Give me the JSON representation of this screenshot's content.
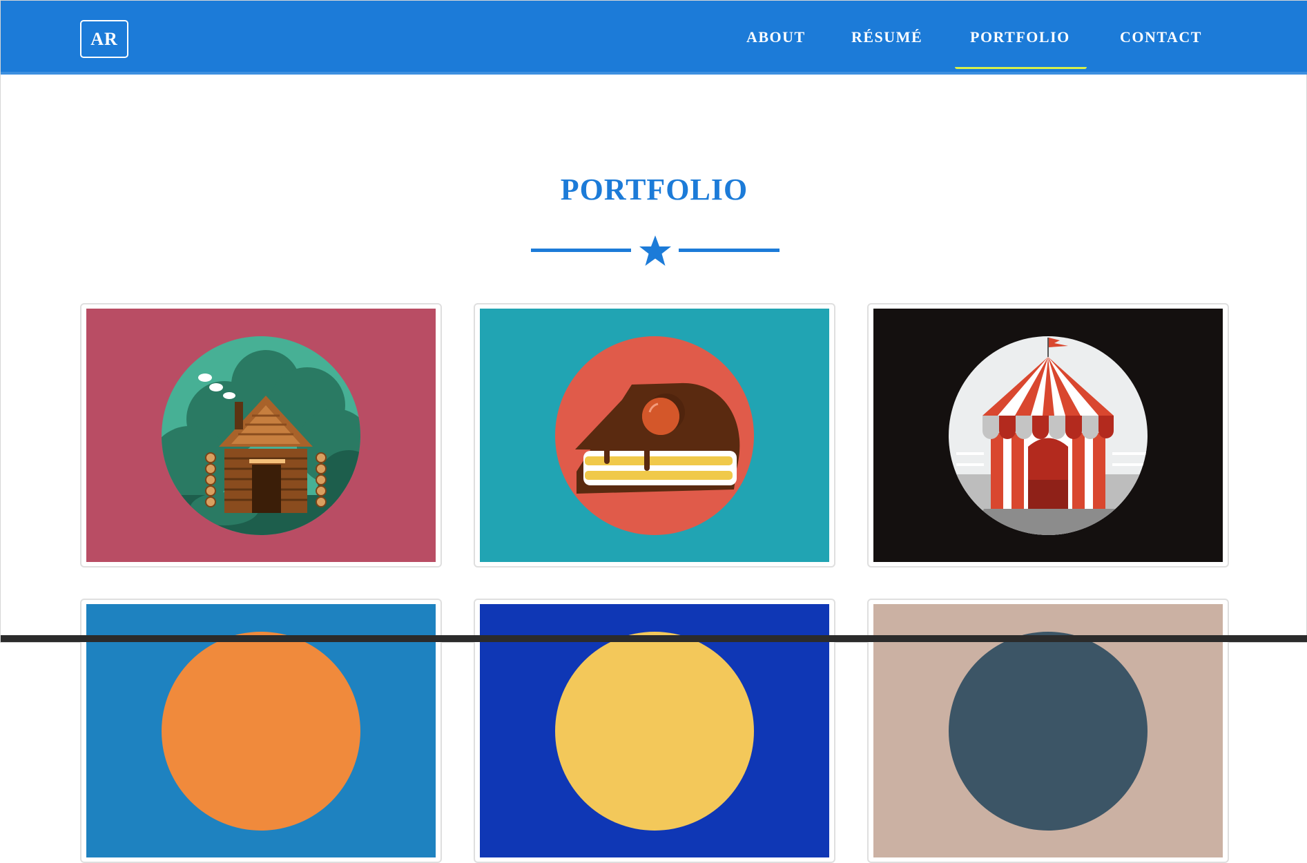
{
  "navbar": {
    "brand": "AR",
    "items": [
      {
        "label": "ABOUT"
      },
      {
        "label": "RÉSUMÉ"
      },
      {
        "label": "PORTFOLIO",
        "active": true
      },
      {
        "label": "CONTACT"
      }
    ]
  },
  "section": {
    "title": "PORTFOLIO",
    "divider_icon": "star-icon"
  },
  "portfolio": {
    "items": [
      {
        "name": "log-cabin",
        "icon": "cabin-icon",
        "background": "#b94d64"
      },
      {
        "name": "cake-slice",
        "icon": "cake-icon",
        "background": "#21a4b3"
      },
      {
        "name": "circus-tent",
        "icon": "circus-tent-icon",
        "background": "#14100f"
      },
      {
        "name": "item-4",
        "background": "#1e82c0"
      },
      {
        "name": "item-5",
        "background": "#0f37b5"
      },
      {
        "name": "item-6",
        "background": "#cbb1a3"
      }
    ]
  },
  "colors": {
    "primary": "#1c7bd8",
    "nav_active_underline": "#d7f04a",
    "white": "#ffffff"
  }
}
